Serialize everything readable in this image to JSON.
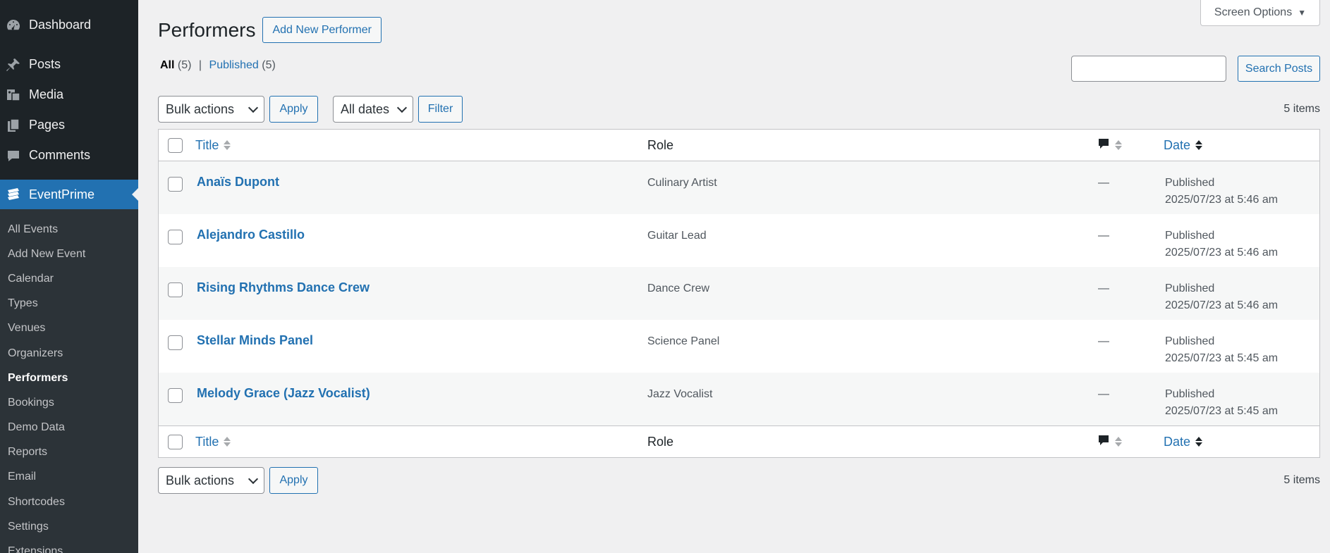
{
  "sidebar": {
    "top_items": [
      {
        "label": "Dashboard",
        "icon": "dashboard-icon"
      },
      {
        "label": "Posts",
        "icon": "pin-icon"
      },
      {
        "label": "Media",
        "icon": "media-icon"
      },
      {
        "label": "Pages",
        "icon": "pages-icon"
      },
      {
        "label": "Comments",
        "icon": "comment-icon"
      },
      {
        "label": "EventPrime",
        "icon": "eventprime-icon"
      }
    ],
    "submenu": [
      "All Events",
      "Add New Event",
      "Calendar",
      "Types",
      "Venues",
      "Organizers",
      "Performers",
      "Bookings",
      "Demo Data",
      "Reports",
      "Email",
      "Shortcodes",
      "Settings",
      "Extensions"
    ],
    "current_submenu": "Performers"
  },
  "header": {
    "screen_options": "Screen Options",
    "title": "Performers",
    "add_new": "Add New Performer"
  },
  "views": {
    "all_label": "All",
    "all_count": "(5)",
    "separator": "|",
    "published_label": "Published",
    "published_count": "(5)"
  },
  "search": {
    "button": "Search Posts",
    "value": ""
  },
  "tablenav": {
    "bulk_actions": "Bulk actions",
    "apply": "Apply",
    "dates": "All dates",
    "filter": "Filter",
    "items_count": "5 items"
  },
  "table": {
    "columns": {
      "title": "Title",
      "role": "Role",
      "date": "Date"
    },
    "rows": [
      {
        "title": "Anaïs Dupont",
        "role": "Culinary Artist",
        "comments": "—",
        "status": "Published",
        "date": "2025/07/23 at 5:46 am"
      },
      {
        "title": "Alejandro Castillo",
        "role": "Guitar Lead",
        "comments": "—",
        "status": "Published",
        "date": "2025/07/23 at 5:46 am"
      },
      {
        "title": "Rising Rhythms Dance Crew",
        "role": "Dance Crew",
        "comments": "—",
        "status": "Published",
        "date": "2025/07/23 at 5:46 am"
      },
      {
        "title": "Stellar Minds Panel",
        "role": "Science Panel",
        "comments": "—",
        "status": "Published",
        "date": "2025/07/23 at 5:45 am"
      },
      {
        "title": "Melody Grace (Jazz Vocalist)",
        "role": "Jazz Vocalist",
        "comments": "—",
        "status": "Published",
        "date": "2025/07/23 at 5:45 am"
      }
    ]
  },
  "colors": {
    "sidebar_bg": "#1d2327",
    "submenu_bg": "#2c3338",
    "accent": "#2271b1",
    "page_bg": "#f0f0f1"
  }
}
